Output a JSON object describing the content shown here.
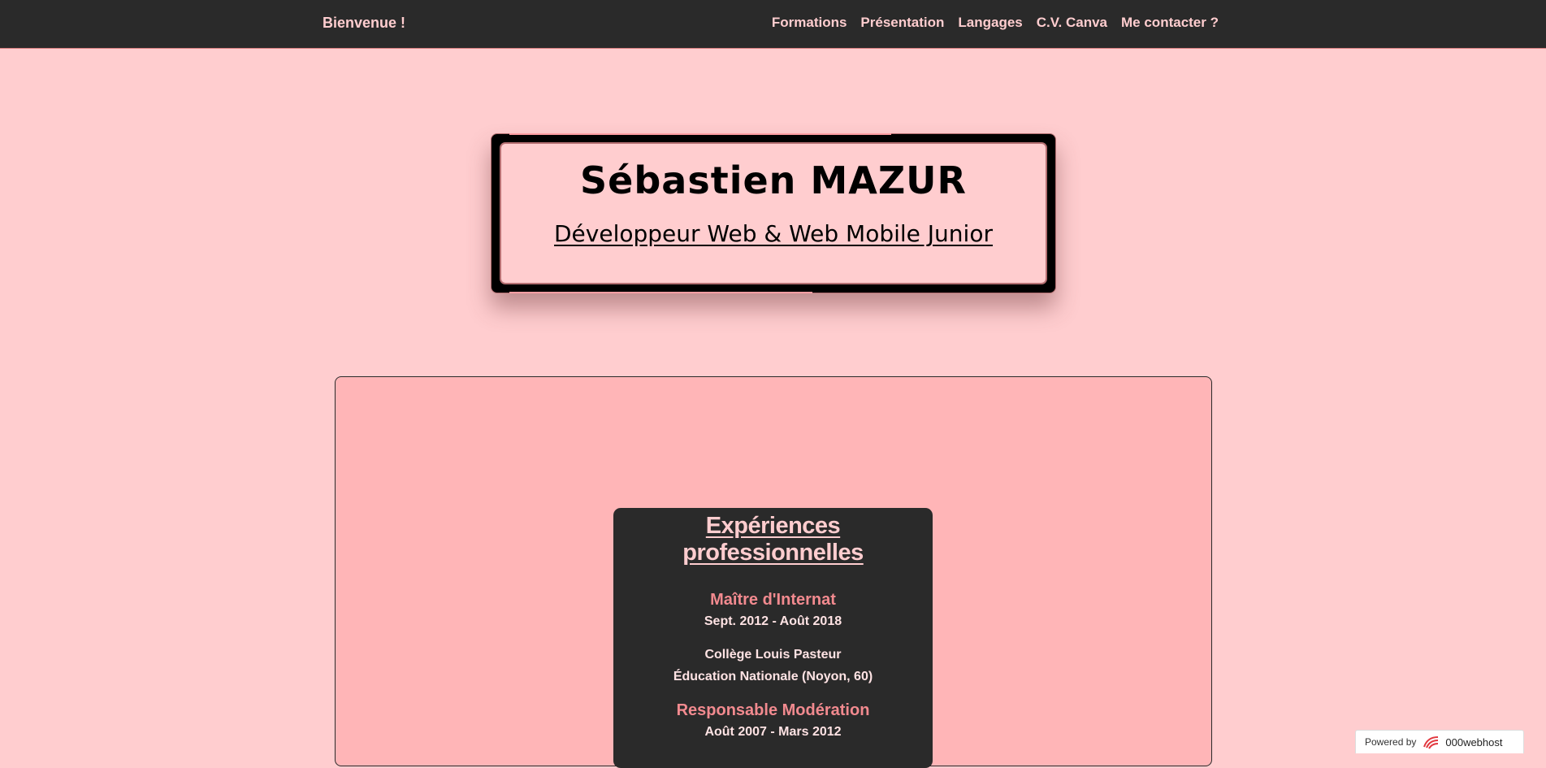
{
  "navbar": {
    "brand": "Bienvenue !",
    "links": [
      {
        "label": "Formations"
      },
      {
        "label": "Présentation"
      },
      {
        "label": "Langages"
      },
      {
        "label": "C.V. Canva"
      },
      {
        "label": "Me contacter ?"
      }
    ]
  },
  "hero": {
    "name": "Sébastien MAZUR",
    "role": "Développeur Web & Web Mobile Junior"
  },
  "experiences": {
    "heading": "Expériences professionnelles",
    "jobs": [
      {
        "title": "Maître d'Internat",
        "dates": "Sept. 2012 - Août 2018",
        "place_line1": "Collège Louis Pasteur",
        "place_line2": "Éducation Nationale (Noyon, 60)"
      },
      {
        "title": "Responsable Modération",
        "dates": "Août 2007 - Mars 2012"
      }
    ]
  },
  "footer_badge": {
    "prefix": "Powered by",
    "host": "000webhost"
  },
  "colors": {
    "background": "#ffcdcf",
    "navbar": "#2a2a2a",
    "panel": "#ffb5b7",
    "accent": "#f28a8f"
  }
}
